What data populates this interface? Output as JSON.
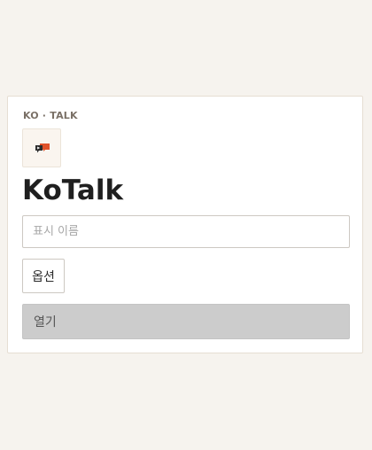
{
  "card": {
    "eyebrow": "KO · TALK",
    "logo_icon": "chat-bubbles-icon",
    "title": "KoTalk"
  },
  "form": {
    "display_name_placeholder": "표시 이름",
    "display_name_value": "",
    "options_label": "옵션",
    "open_label": "열기",
    "open_disabled": true
  },
  "colors": {
    "background": "#f6f3ee",
    "accent": "#e0522a",
    "logo_dark": "#2b2b2b",
    "disabled_button": "#cccccc"
  }
}
